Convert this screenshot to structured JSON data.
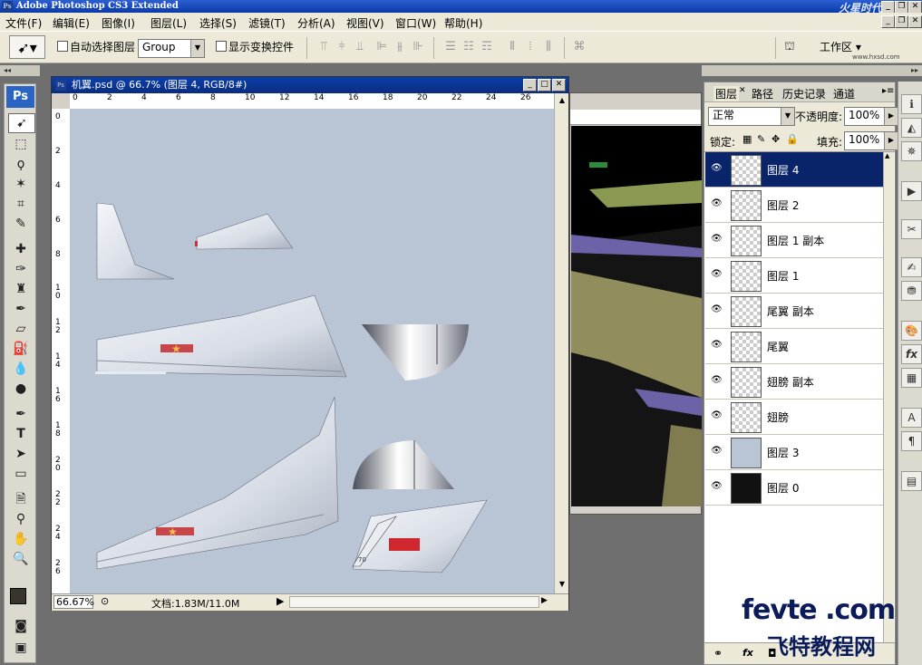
{
  "app": {
    "title": "Adobe Photoshop CS3 Extended",
    "logo": "Ps"
  },
  "menubar": {
    "items": [
      "文件(F)",
      "编辑(E)",
      "图像(I)",
      "图层(L)",
      "选择(S)",
      "滤镜(T)",
      "分析(A)",
      "视图(V)",
      "窗口(W)",
      "帮助(H)"
    ]
  },
  "options": {
    "auto_select_label": "自动选择图层",
    "group_value": "Group",
    "show_transform_label": "显示变换控件",
    "workspace_label": "工作区 ▾"
  },
  "document": {
    "title": "机翼.psd @ 66.7% (图层 4, RGB/8#)",
    "zoom": "66.67%",
    "doc_size": "文档:1.83M/11.0M",
    "ruler_h": [
      "0",
      "2",
      "4",
      "6",
      "8",
      "10",
      "12",
      "14",
      "16",
      "18",
      "20",
      "22",
      "24",
      "26"
    ],
    "ruler_v": [
      "0",
      "2",
      "4",
      "6",
      "8",
      "1\n0",
      "1\n2",
      "1\n4",
      "1\n6",
      "1\n8",
      "2\n0",
      "2\n2",
      "2\n4",
      "2\n6"
    ]
  },
  "layers_panel": {
    "tabs": [
      "图层",
      "路径",
      "历史记录",
      "通道"
    ],
    "blend_mode": "正常",
    "opacity_label": "不透明度:",
    "opacity_value": "100%",
    "lock_label": "锁定:",
    "fill_label": "填充:",
    "fill_value": "100%",
    "layers": [
      {
        "name": "图层 4",
        "selected": true,
        "thumb": "transparent"
      },
      {
        "name": "图层 2",
        "selected": false,
        "thumb": "transparent"
      },
      {
        "name": "图层 1 副本",
        "selected": false,
        "thumb": "transparent"
      },
      {
        "name": "图层 1",
        "selected": false,
        "thumb": "transparent"
      },
      {
        "name": "尾翼 副本",
        "selected": false,
        "thumb": "transparent"
      },
      {
        "name": "尾翼",
        "selected": false,
        "thumb": "transparent"
      },
      {
        "name": "翅膀 副本",
        "selected": false,
        "thumb": "transparent"
      },
      {
        "name": "翅膀",
        "selected": false,
        "thumb": "transparent"
      },
      {
        "name": "图层 3",
        "selected": false,
        "thumb": "solid"
      },
      {
        "name": "图层 0",
        "selected": false,
        "thumb": "image"
      }
    ]
  },
  "watermark": {
    "site": "fevte .com",
    "cn": "飞特教程网",
    "corner": "火星时代"
  },
  "colors": {
    "canvas": "#b9c4d4",
    "selected_layer": "#0a246a",
    "titlebar": "#0a3aa8"
  }
}
